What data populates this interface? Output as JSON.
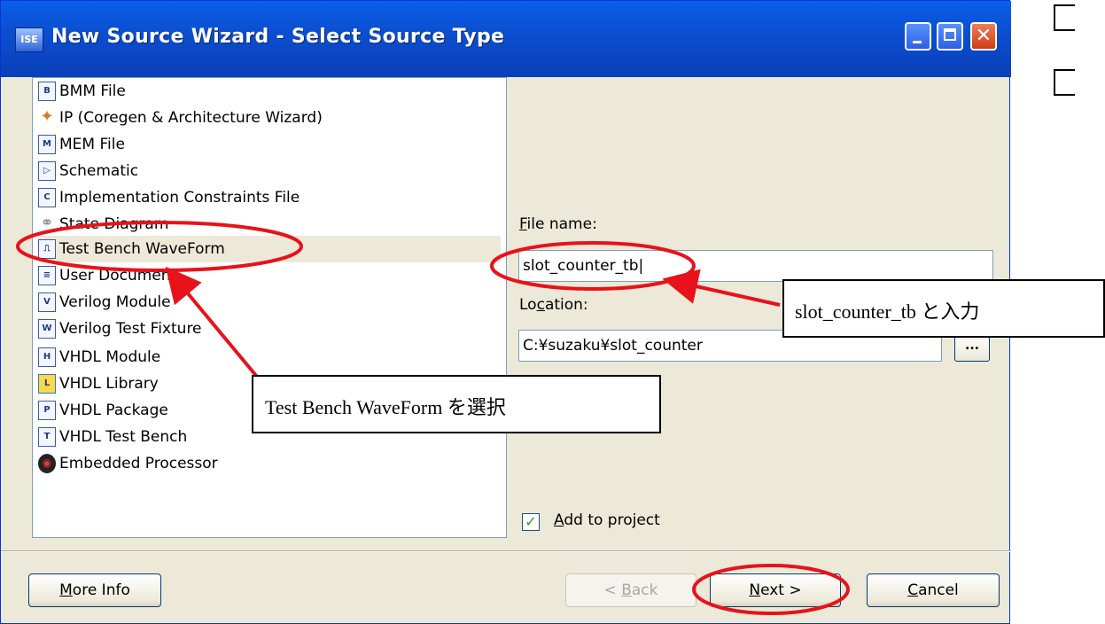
{
  "window": {
    "app_icon": "ISE",
    "title": "New Source Wizard - Select Source Type",
    "close_glyph": "✕"
  },
  "source_list": {
    "selected_index": 6,
    "items": [
      {
        "icon": "bmm-file-icon",
        "glyph": "B",
        "label": "BMM File"
      },
      {
        "icon": "ip-wizard-icon",
        "glyph": "✦",
        "label": "IP (Coregen & Architecture Wizard)"
      },
      {
        "icon": "mem-file-icon",
        "glyph": "M",
        "label": "MEM File"
      },
      {
        "icon": "schematic-icon",
        "glyph": "▷",
        "label": "Schematic"
      },
      {
        "icon": "constraints-file-icon",
        "glyph": "C",
        "label": "Implementation Constraints File"
      },
      {
        "icon": "state-diagram-icon",
        "glyph": "⚭",
        "label": "State Diagram"
      },
      {
        "icon": "waveform-icon",
        "glyph": "⎍",
        "label": "Test Bench WaveForm"
      },
      {
        "icon": "document-icon",
        "glyph": "≡",
        "label": "User Document"
      },
      {
        "icon": "verilog-module-icon",
        "glyph": "V",
        "label": "Verilog Module"
      },
      {
        "icon": "verilog-fixture-icon",
        "glyph": "W",
        "label": "Verilog Test Fixture"
      },
      {
        "icon": "vhdl-module-icon",
        "glyph": "H",
        "label": "VHDL Module"
      },
      {
        "icon": "vhdl-library-icon",
        "glyph": "L",
        "label": "VHDL Library"
      },
      {
        "icon": "vhdl-package-icon",
        "glyph": "P",
        "label": "VHDL Package"
      },
      {
        "icon": "vhdl-testbench-icon",
        "glyph": "T",
        "label": "VHDL Test Bench"
      },
      {
        "icon": "embedded-processor-icon",
        "glyph": "◉",
        "label": "Embedded Processor"
      }
    ]
  },
  "form": {
    "file_name_label": "File name:",
    "file_name_value": "slot_counter_tb",
    "location_label": "Location:",
    "location_value": "C:¥suzaku¥slot_counter",
    "browse_label": "...",
    "add_to_project_label": "Add to project",
    "add_to_project_checked": true,
    "check_glyph": "✓"
  },
  "buttons": {
    "more_info": "More Info",
    "back": "< Back",
    "next": "Next >",
    "cancel": "Cancel"
  },
  "annotations": {
    "select_note": "Test Bench WaveForm を選択",
    "input_note": "slot_counter_tb と入力",
    "highlight_color": "#e8121a"
  }
}
